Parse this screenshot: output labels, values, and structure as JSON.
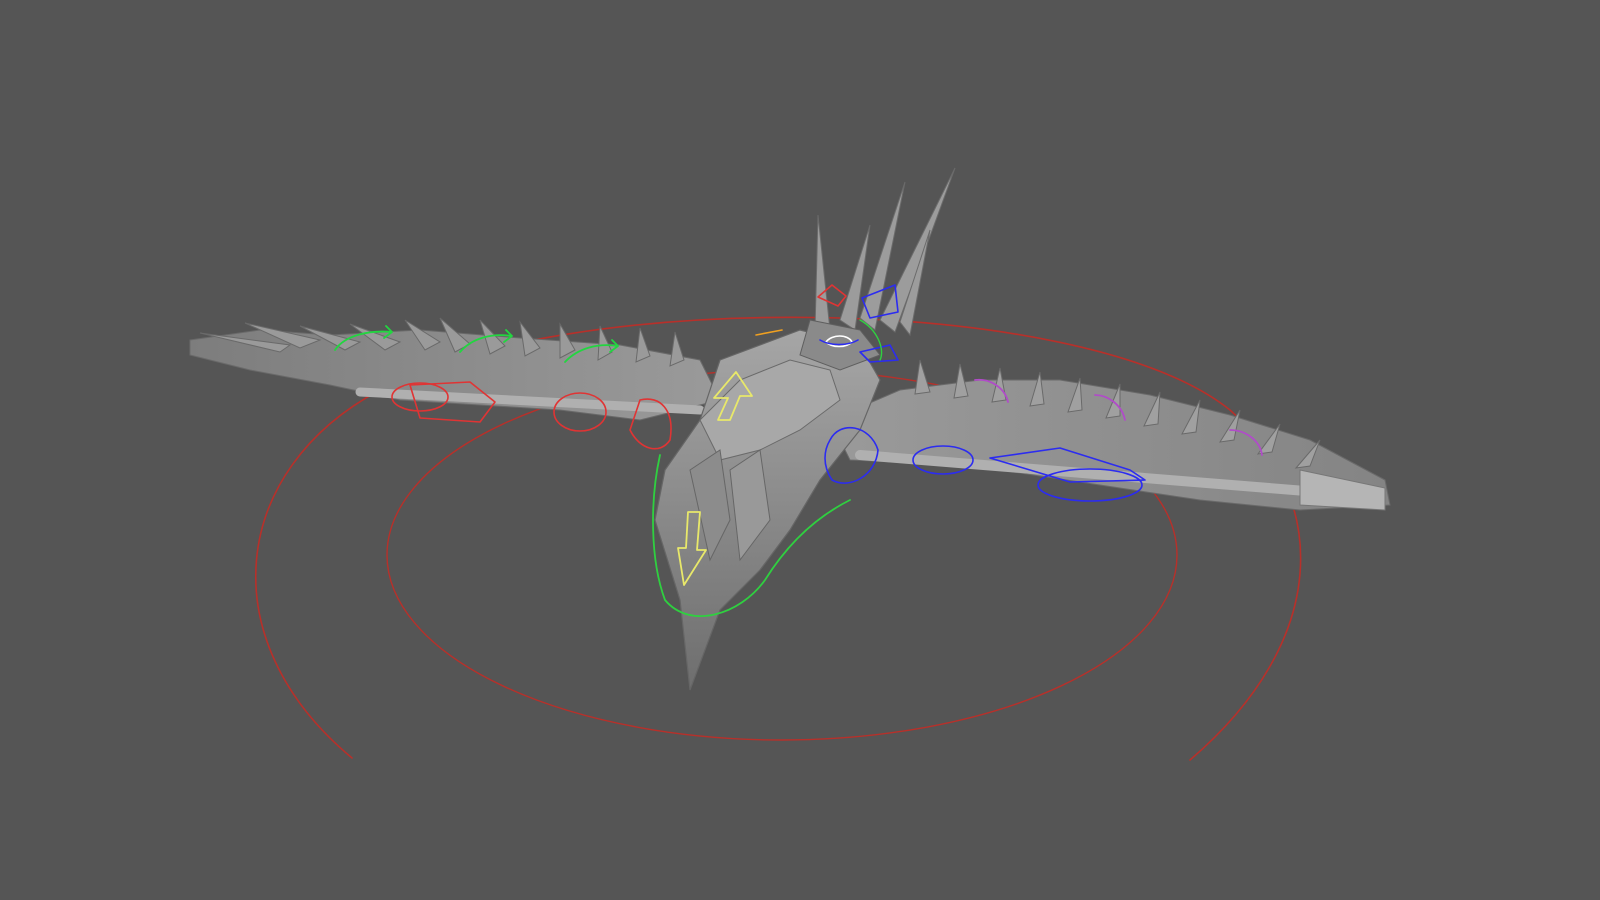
{
  "viewport": {
    "background": "#555555",
    "shading": "smooth-shaded-mesh"
  },
  "model": {
    "subject": "bird-rig",
    "mesh_color": "#8e8e8e",
    "mesh_highlight": "#b9b9b9",
    "mesh_shadow": "#6a6a6a"
  },
  "controls": {
    "root_color": "#c0302a",
    "left_wing_fk_color": "#e03434",
    "right_wing_fk_color": "#2c2cf0",
    "feather_curl_left_color": "#22d640",
    "feather_curl_right_color": "#b04cc8",
    "body_color": "#2fd040",
    "spine_arrow_color": "#e8e86a",
    "head_color": "#ffffff"
  }
}
